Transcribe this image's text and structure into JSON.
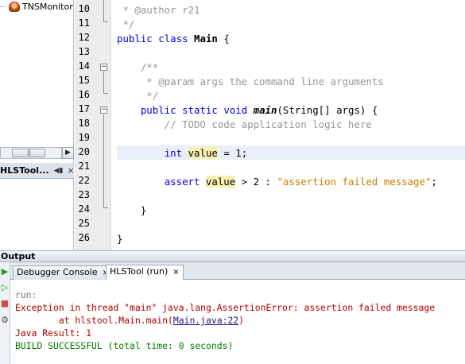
{
  "project_tree": {
    "item_label": "TNSMonitor",
    "item_icon": "coffee-cup-icon"
  },
  "navigator_tab": {
    "label": "HLSTool...",
    "controls": "◀▮",
    "close": "×"
  },
  "editor": {
    "line_numbers": [
      "10",
      "11",
      "12",
      "13",
      "14",
      "15",
      "16",
      "17",
      "18",
      "19",
      "20",
      "21",
      "22",
      "23",
      "24",
      "25",
      "26"
    ],
    "lines": {
      "l10": {
        "star": " * ",
        "tag": "@author",
        "rest": " r21"
      },
      "l11": {
        "text": " */"
      },
      "l12": {
        "kw1": "public",
        "kw2": "class",
        "name": "Main",
        "rest": " {"
      },
      "l14": {
        "text": "    /**"
      },
      "l15": {
        "star": "     * ",
        "tag": "@param",
        "rest": " args the command line arguments"
      },
      "l16": {
        "text": "     */"
      },
      "l17": {
        "kw1": "public",
        "kw2": "static",
        "kw3": "void",
        "name": "main",
        "rest": "(String[] args) {"
      },
      "l18": {
        "text": "        // TODO code application logic here"
      },
      "l20": {
        "kw": "int",
        "var": "value",
        "rest": " = 1;"
      },
      "l22": {
        "kw": "assert",
        "var": "value",
        "mid": " > 2 : ",
        "str": "\"assertion failed message\"",
        "end": ";"
      },
      "l24": {
        "text": "    }"
      },
      "l26": {
        "text": "}"
      }
    }
  },
  "output": {
    "header": "Output",
    "tabs": [
      {
        "label": "Debugger Console",
        "close": "×"
      },
      {
        "label": "HLSTool (run)",
        "close": "×"
      }
    ],
    "lines": {
      "run": "run:",
      "exception": "Exception in thread \"main\" java.lang.AssertionError: assertion failed message",
      "at_prefix": "        at hlstool.Main.main(",
      "at_link": "Main.java:22",
      "at_suffix": ")",
      "java_result": "Java Result: 1",
      "build": "BUILD SUCCESSFUL (total time: 0 seconds)"
    },
    "toolbar_icons": [
      "run-icon",
      "rerun-icon",
      "stop-icon",
      "settings-icon"
    ]
  },
  "colors": {
    "keyword": "#0000e6",
    "comment": "#969696",
    "string": "#ce7b00",
    "error": "#b00000",
    "success": "#007a00",
    "highlight": "#f7f0b0",
    "caret_line": "#e9eff8"
  }
}
